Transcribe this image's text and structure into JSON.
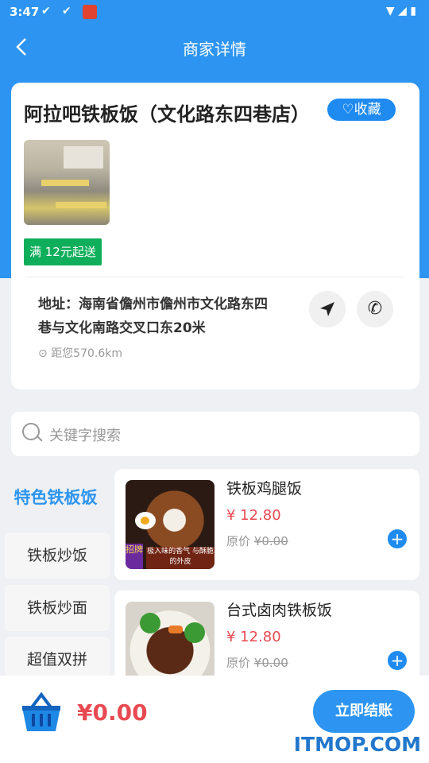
{
  "status_bar": {
    "time": "3:47"
  },
  "nav": {
    "title": "商家详情"
  },
  "shop": {
    "name": "阿拉吧铁板饭（文化路东四巷店）",
    "favorite_label": "♡收藏",
    "min_order_label": "满 12元起送",
    "address": "地址：海南省儋州市儋州市文化路东四巷与文化南路交叉口东20米",
    "distance": "距您570.6km"
  },
  "search": {
    "placeholder": "关键字搜索"
  },
  "categories": [
    "特色铁板饭",
    "铁板炒饭",
    "铁板炒面",
    "超值双拼"
  ],
  "items": [
    {
      "name": "铁板鸡腿饭",
      "price": "¥ 12.80",
      "orig_label": "原价",
      "orig_price": "¥0.00",
      "banner_left": "招牌",
      "banner_right": "极入味的香气 与酥脆的外皮"
    },
    {
      "name": "台式卤肉铁板饭",
      "price": "¥ 12.80",
      "orig_label": "原价",
      "orig_price": "¥0.00"
    }
  ],
  "cart": {
    "total": "¥0.00",
    "checkout_label": "立即结账"
  },
  "watermark": "ITMOP.COM",
  "colors": {
    "primary": "#2d95f1",
    "price": "#e84a52",
    "badge": "#0fae5b"
  },
  "icons": [
    "back-arrow-icon",
    "heart-icon",
    "navigate-icon",
    "phone-icon",
    "location-pin-icon",
    "search-icon",
    "plus-icon",
    "basket-icon"
  ]
}
